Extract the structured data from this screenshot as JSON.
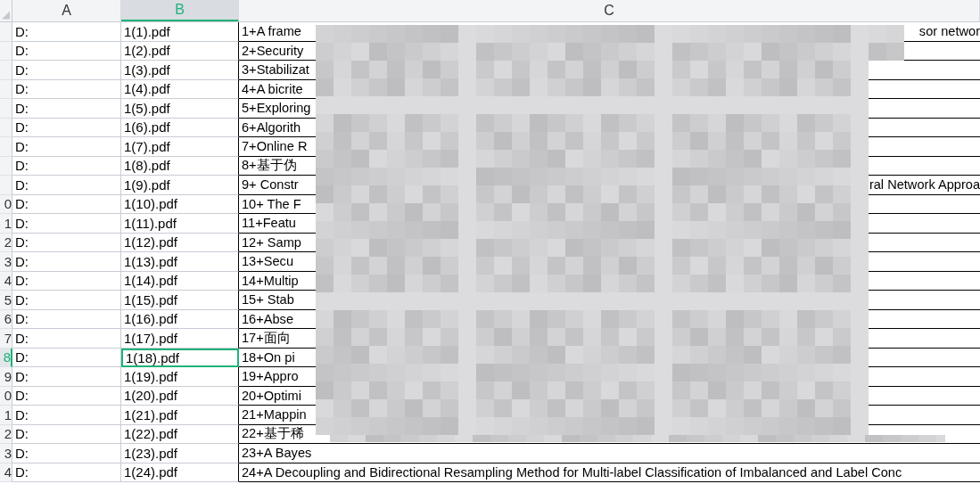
{
  "columns": [
    {
      "label": "A",
      "selected": false
    },
    {
      "label": "B",
      "selected": true
    },
    {
      "label": "C",
      "selected": false
    }
  ],
  "rows": [
    {
      "selected": false,
      "a": "D:",
      "b": "1(1).pdf",
      "c": "1+A frame",
      "c_end": "sor networ"
    },
    {
      "selected": false,
      "a": "D:",
      "b": "1(2).pdf",
      "c": "2+Security"
    },
    {
      "selected": false,
      "a": "D:",
      "b": "1(3).pdf",
      "c": "3+Stabilizat"
    },
    {
      "selected": false,
      "a": "D:",
      "b": "1(4).pdf",
      "c": "4+A bicrite"
    },
    {
      "selected": false,
      "a": "D:",
      "b": "1(5).pdf",
      "c": "5+Exploring"
    },
    {
      "selected": false,
      "a": "D:",
      "b": "1(6).pdf",
      "c": "6+Algorith"
    },
    {
      "selected": false,
      "a": "D:",
      "b": "1(7).pdf",
      "c": "7+Online R"
    },
    {
      "selected": false,
      "a": "D:",
      "b": "1(8).pdf",
      "c": "8+基于伪"
    },
    {
      "selected": false,
      "a": "D:",
      "b": "1(9).pdf",
      "c": "9+ Constr",
      "c_end": "ral Network Approa"
    },
    {
      "selected": false,
      "row_label": "0",
      "a": "D:",
      "b": "1(10).pdf",
      "c": "10+ The F"
    },
    {
      "selected": false,
      "row_label": "1",
      "a": "D:",
      "b": "1(11).pdf",
      "c": "11+Featu"
    },
    {
      "selected": false,
      "row_label": "2",
      "a": "D:",
      "b": "1(12).pdf",
      "c": "12+ Samp"
    },
    {
      "selected": false,
      "row_label": "3",
      "a": "D:",
      "b": "1(13).pdf",
      "c": "13+Secu"
    },
    {
      "selected": false,
      "row_label": "4",
      "a": "D:",
      "b": "1(14).pdf",
      "c": "14+Multip"
    },
    {
      "selected": false,
      "row_label": "5",
      "a": "D:",
      "b": "1(15).pdf",
      "c": "15+ Stab"
    },
    {
      "selected": false,
      "row_label": "6",
      "a": "D:",
      "b": "1(16).pdf",
      "c": "16+Abse"
    },
    {
      "selected": false,
      "row_label": "7",
      "a": "D:",
      "b": "1(17).pdf",
      "c": "17+面向"
    },
    {
      "selected": true,
      "row_label": "8",
      "a": "D:",
      "b": "1(18).pdf",
      "c": "18+On pi"
    },
    {
      "selected": false,
      "row_label": "9",
      "a": "D:",
      "b": "1(19).pdf",
      "c": "19+Appro"
    },
    {
      "selected": false,
      "row_label": "0",
      "a": "D:",
      "b": "1(20).pdf",
      "c": "20+Optimi"
    },
    {
      "selected": false,
      "row_label": "1",
      "a": "D:",
      "b": "1(21).pdf",
      "c": "21+Mappin"
    },
    {
      "selected": false,
      "row_label": "2",
      "a": "D:",
      "b": "1(22).pdf",
      "c": "22+基于稀"
    },
    {
      "selected": false,
      "row_label": "3",
      "a": "D:",
      "b": "1(23).pdf",
      "c": "23+A Bayes"
    },
    {
      "selected": false,
      "row_label": "4",
      "a": "D:",
      "b": "1(24).pdf",
      "c": "24+A Decoupling and Bidirectional Resampling Method for Multi-label Classification of Imbalanced and Label Conc"
    }
  ]
}
